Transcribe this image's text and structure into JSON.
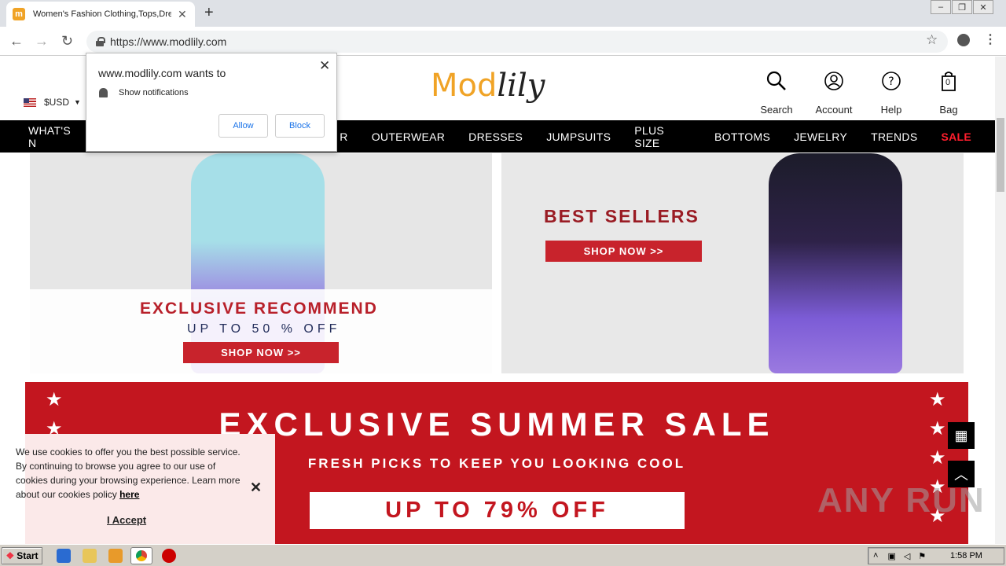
{
  "browser": {
    "tab_title": "Women's Fashion Clothing,Tops,Dre",
    "url": "https://www.modlily.com",
    "new_tab": "+",
    "close_tab": "✕"
  },
  "header": {
    "currency": "$USD",
    "logo_mod": "Mod",
    "logo_lily": "lily",
    "icons": {
      "search": "Search",
      "account": "Account",
      "help": "Help",
      "bag": "Bag",
      "bag_count": "0"
    }
  },
  "nav": {
    "items": [
      "WHAT'S N",
      "R",
      "OUTERWEAR",
      "DRESSES",
      "JUMPSUITS",
      "PLUS SIZE",
      "BOTTOMS",
      "JEWELRY",
      "TRENDS",
      "SALE"
    ],
    "sale_color": "#ff1e2d"
  },
  "banners": {
    "left": {
      "title": "EXCLUSIVE RECOMMEND",
      "subtitle": "UP TO 50 % OFF",
      "button": "SHOP NOW >>"
    },
    "right": {
      "title": "BEST SELLERS",
      "button": "SHOP NOW >>"
    }
  },
  "sale": {
    "title": "EXCLUSIVE SUMMER SALE",
    "subtitle": "FRESH PICKS TO KEEP YOU LOOKING COOL",
    "box": "UP TO 79% OFF"
  },
  "cookie": {
    "text": "We use cookies to offer you the best possible service. By continuing to browse you agree to our use of cookies during your browsing experience. Learn more about our cookies policy",
    "link": "here",
    "accept": "I Accept"
  },
  "notification": {
    "title": "www.modlily.com wants to",
    "permission": "Show notifications",
    "allow": "Allow",
    "block": "Block"
  },
  "watermark": "ANY RUN",
  "taskbar": {
    "start": "Start",
    "time": "1:58 PM"
  }
}
